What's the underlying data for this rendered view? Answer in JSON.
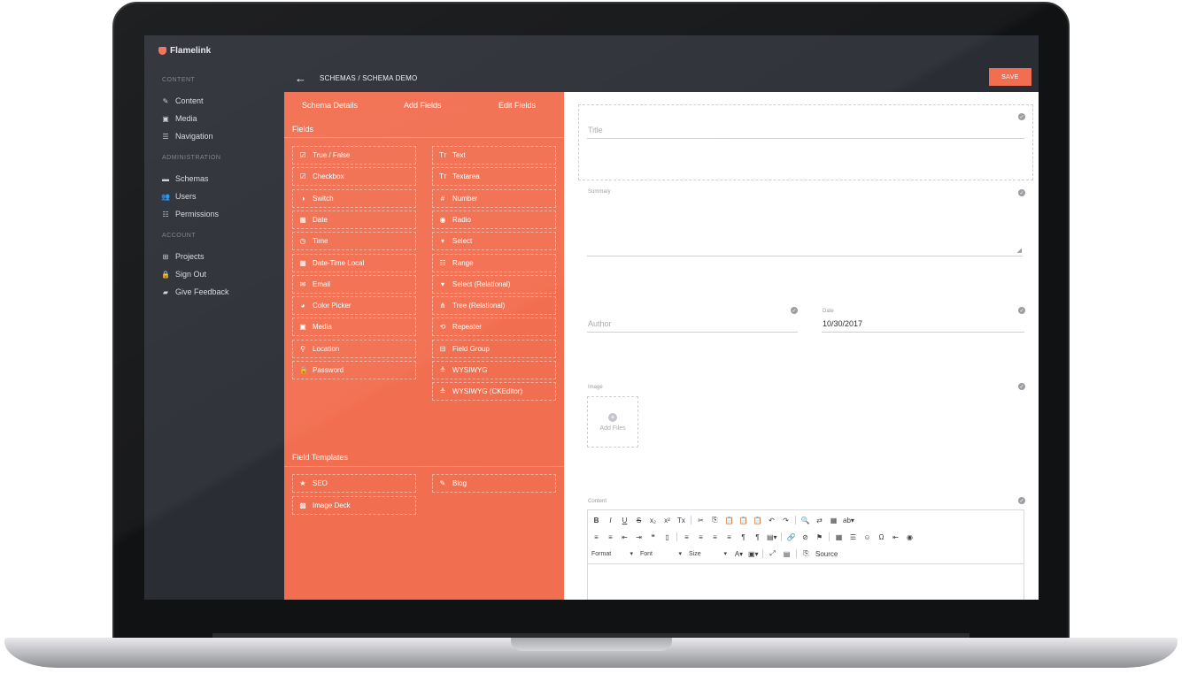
{
  "app": {
    "brand": "Flamelink"
  },
  "sidebar": {
    "sections": [
      {
        "title": "CONTENT",
        "items": [
          {
            "label": "Content",
            "icon": "pencil-icon"
          },
          {
            "label": "Media",
            "icon": "image-folder-icon"
          },
          {
            "label": "Navigation",
            "icon": "menu-icon"
          }
        ]
      },
      {
        "title": "ADMINISTRATION",
        "items": [
          {
            "label": "Schemas",
            "icon": "schema-icon"
          },
          {
            "label": "Users",
            "icon": "users-icon"
          },
          {
            "label": "Permissions",
            "icon": "sliders-icon"
          }
        ]
      },
      {
        "title": "ACCOUNT",
        "items": [
          {
            "label": "Projects",
            "icon": "grid-icon"
          },
          {
            "label": "Sign Out",
            "icon": "lock-icon"
          },
          {
            "label": "Give Feedback",
            "icon": "feedback-icon"
          }
        ]
      }
    ]
  },
  "header": {
    "breadcrumb": "SCHEMAS / SCHEMA DEMO",
    "save_label": "SAVE"
  },
  "panel": {
    "tabs": [
      "Schema Details",
      "Add Fields",
      "Edit Fields"
    ],
    "fields_title": "Fields",
    "fields_left": [
      {
        "label": "True / False",
        "icon": "checkbox-icon"
      },
      {
        "label": "Checkbox",
        "icon": "checkbox-icon"
      },
      {
        "label": "Switch",
        "icon": "toggle-icon"
      },
      {
        "label": "Date",
        "icon": "calendar-icon"
      },
      {
        "label": "Time",
        "icon": "clock-icon"
      },
      {
        "label": "Date-Time Local",
        "icon": "calendar-icon"
      },
      {
        "label": "Email",
        "icon": "mail-icon"
      },
      {
        "label": "Color Picker",
        "icon": "palette-icon"
      },
      {
        "label": "Media",
        "icon": "media-icon"
      },
      {
        "label": "Location",
        "icon": "pin-icon"
      },
      {
        "label": "Password",
        "icon": "lock-icon"
      }
    ],
    "fields_right": [
      {
        "label": "Text",
        "icon": "text-icon"
      },
      {
        "label": "Textarea",
        "icon": "text-icon"
      },
      {
        "label": "Number",
        "icon": "number-icon"
      },
      {
        "label": "Radio",
        "icon": "radio-icon"
      },
      {
        "label": "Select",
        "icon": "select-icon"
      },
      {
        "label": "Range",
        "icon": "range-icon"
      },
      {
        "label": "Select (Relational)",
        "icon": "select-icon"
      },
      {
        "label": "Tree (Relational)",
        "icon": "tree-icon"
      },
      {
        "label": "Repeater",
        "icon": "repeat-icon"
      },
      {
        "label": "Field Group",
        "icon": "group-icon"
      },
      {
        "label": "WYSIWYG",
        "icon": "editor-icon"
      },
      {
        "label": "WYSIWYG (CKEditor)",
        "icon": "editor-icon"
      }
    ],
    "templates_title": "Field Templates",
    "templates": [
      {
        "label": "SEO",
        "icon": "star-icon"
      },
      {
        "label": "Blog",
        "icon": "pencil-icon"
      },
      {
        "label": "Image Deck",
        "icon": "image-icon"
      }
    ]
  },
  "form": {
    "title_placeholder": "Title",
    "summary_label": "Summary",
    "author_placeholder": "Author",
    "date_label": "Date",
    "date_value": "10/30/2017",
    "image_label": "Image",
    "add_files_label": "Add Files",
    "content_label": "Content",
    "editor": {
      "row1": [
        "B",
        "I",
        "U",
        "S",
        "x₂",
        "x²",
        "Tx",
        "|",
        "✂",
        "⎘",
        "📋",
        "📋",
        "📋",
        "↶",
        "↷",
        "|",
        "🔍",
        "⇄",
        "▦",
        "ab▾"
      ],
      "row2": [
        "≡",
        "≡",
        "⇤",
        "⇥",
        "❝",
        "▯",
        "|",
        "≡",
        "≡",
        "≡",
        "≡",
        "¶",
        "¶",
        "▤▾",
        "|",
        "🔗",
        "⊘",
        "⚑",
        "|",
        "▦",
        "☰",
        "☺",
        "Ω",
        "⇤",
        "◉"
      ],
      "format_label": "Format",
      "font_label": "Font",
      "size_label": "Size",
      "source_label": "Source"
    }
  }
}
